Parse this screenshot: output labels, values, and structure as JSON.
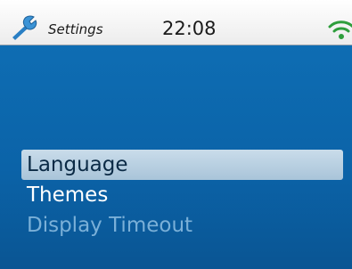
{
  "status_bar": {
    "app_icon": "wrench-icon",
    "title": "Settings",
    "time": "22:08",
    "signal_icon": "wifi-icon"
  },
  "menu": {
    "items": [
      {
        "label": "Language",
        "state": "selected"
      },
      {
        "label": "Themes",
        "state": "normal"
      },
      {
        "label": "Display Timeout",
        "state": "dimmed"
      }
    ]
  },
  "colors": {
    "background_top": "#0e6db3",
    "background_bottom": "#0a5593",
    "highlight": "#b8cfe0",
    "wifi": "#2e9e3c",
    "wrench": "#2a7fc4"
  }
}
